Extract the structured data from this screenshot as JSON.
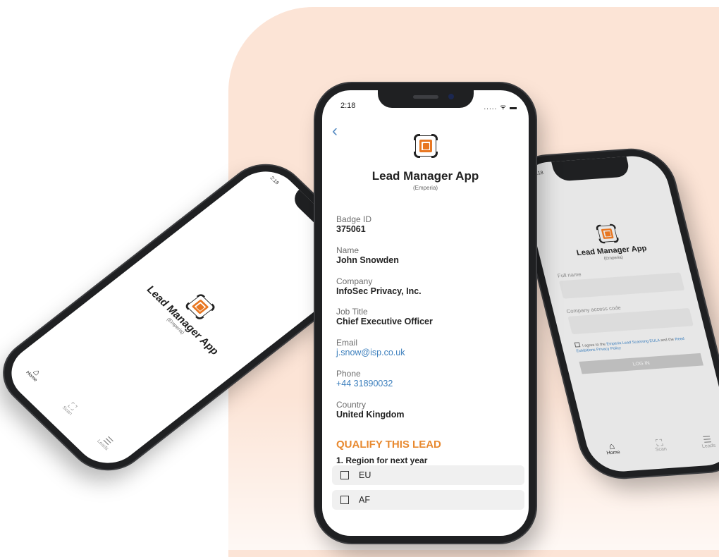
{
  "colors": {
    "accent": "#e8892f",
    "logo_orange": "#e87722",
    "link": "#3c7fbd",
    "background_peach": "#fce4d6"
  },
  "center_phone": {
    "status_time": "2:18",
    "status_icons": "..... ᯤ ▬",
    "back_icon": "chevron-left-icon",
    "app_title": "Lead Manager App",
    "app_subtitle": "(Emperia)",
    "fields": [
      {
        "label": "Badge ID",
        "value": "375061"
      },
      {
        "label": "Name",
        "value": "John Snowden"
      },
      {
        "label": "Company",
        "value": "InfoSec Privacy, Inc."
      },
      {
        "label": "Job Title",
        "value": "Chief Executive Officer"
      },
      {
        "label": "Email",
        "value": "j.snow@isp.co.uk"
      },
      {
        "label": "Phone",
        "value": "+44 31890032"
      },
      {
        "label": "Country",
        "value": "United Kingdom"
      }
    ],
    "qualify_heading": "QUALIFY THIS LEAD",
    "question_1": "1. Region for next year",
    "options": [
      "EU",
      "AF"
    ]
  },
  "left_phone": {
    "status_time": "2:18",
    "app_title": "Lead Manager App",
    "app_subtitle": "(Emperia)",
    "tabs": [
      {
        "label": "Home",
        "icon": "home-icon"
      },
      {
        "label": "Scan",
        "icon": "scan-icon"
      },
      {
        "label": "Leads",
        "icon": "list-icon"
      }
    ]
  },
  "right_phone": {
    "status_time": "2:18",
    "app_title": "Lead Manager App",
    "app_subtitle": "(Emperia)",
    "full_name_placeholder": "Full name",
    "access_code_placeholder": "Company access code",
    "agree_prefix": "I agree to the",
    "agree_link_1": "Emperia Lead Scanning EULA",
    "agree_mid": "and the",
    "agree_link_2": "Reed Exhibitions Privacy Policy",
    "login_label": "LOG IN",
    "tabs": [
      {
        "label": "Home",
        "icon": "home-icon"
      },
      {
        "label": "Scan",
        "icon": "scan-icon"
      },
      {
        "label": "Leads",
        "icon": "list-icon"
      }
    ]
  }
}
